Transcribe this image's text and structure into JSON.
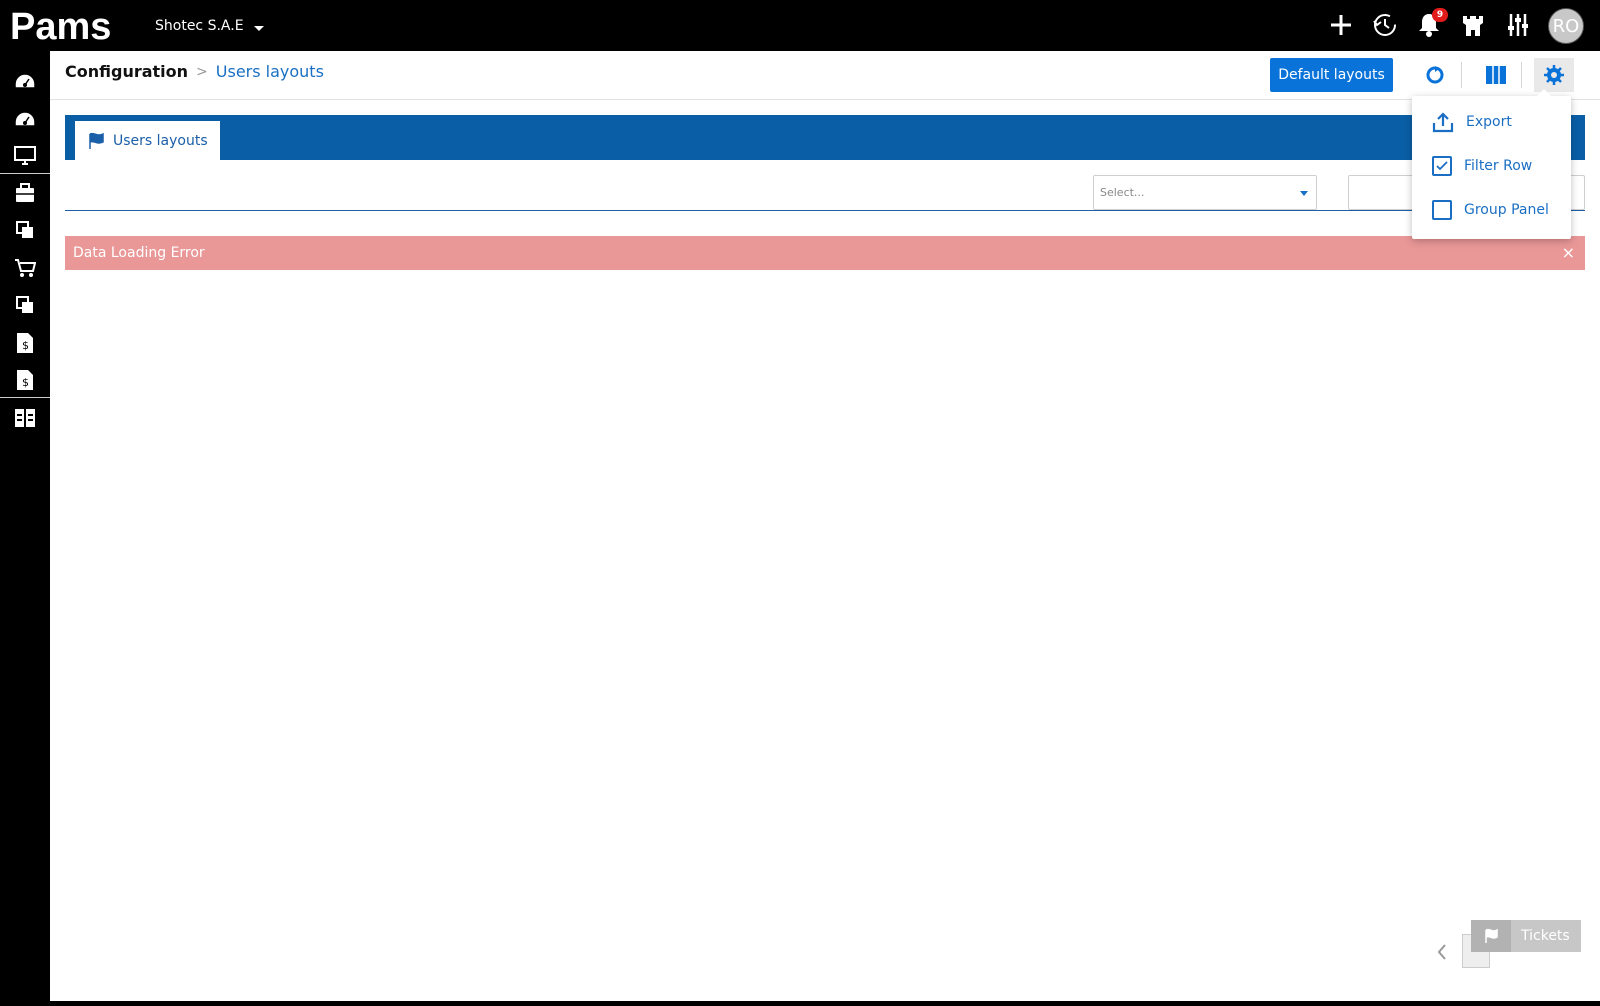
{
  "app": {
    "logo_text": "Pams",
    "company": "Shotec S.A.E",
    "notification_count": "9",
    "user_initials": "RO"
  },
  "sidebar": {
    "items": [
      {
        "icon": "dashboard-icon"
      },
      {
        "icon": "dashboard-icon"
      },
      {
        "icon": "monitor-icon"
      },
      {
        "icon": "briefcase-icon"
      },
      {
        "icon": "documents-icon"
      },
      {
        "icon": "cart-icon"
      },
      {
        "icon": "documents-icon"
      },
      {
        "icon": "invoice-icon"
      },
      {
        "icon": "invoice-icon"
      },
      {
        "icon": "grid-icon"
      }
    ]
  },
  "header": {
    "breadcrumb_root": "Configuration",
    "breadcrumb_separator": ">",
    "breadcrumb_current": "Users layouts",
    "default_layouts_button": "Default layouts"
  },
  "tabs": [
    {
      "label": "Users layouts",
      "active": true
    }
  ],
  "toolbar": {
    "select_placeholder": "Select..."
  },
  "error": {
    "message": "Data Loading Error",
    "close": "×"
  },
  "settings_menu": {
    "export_label": "Export",
    "filter_row_label": "Filter Row",
    "filter_row_checked": true,
    "group_panel_label": "Group Panel",
    "group_panel_checked": false
  },
  "footer": {
    "tickets_label": "Tickets"
  },
  "colors": {
    "accent": "#0a73d9",
    "tabbar": "#0a5ea6",
    "error_bg": "#e99797",
    "badge": "#e21b1b"
  }
}
